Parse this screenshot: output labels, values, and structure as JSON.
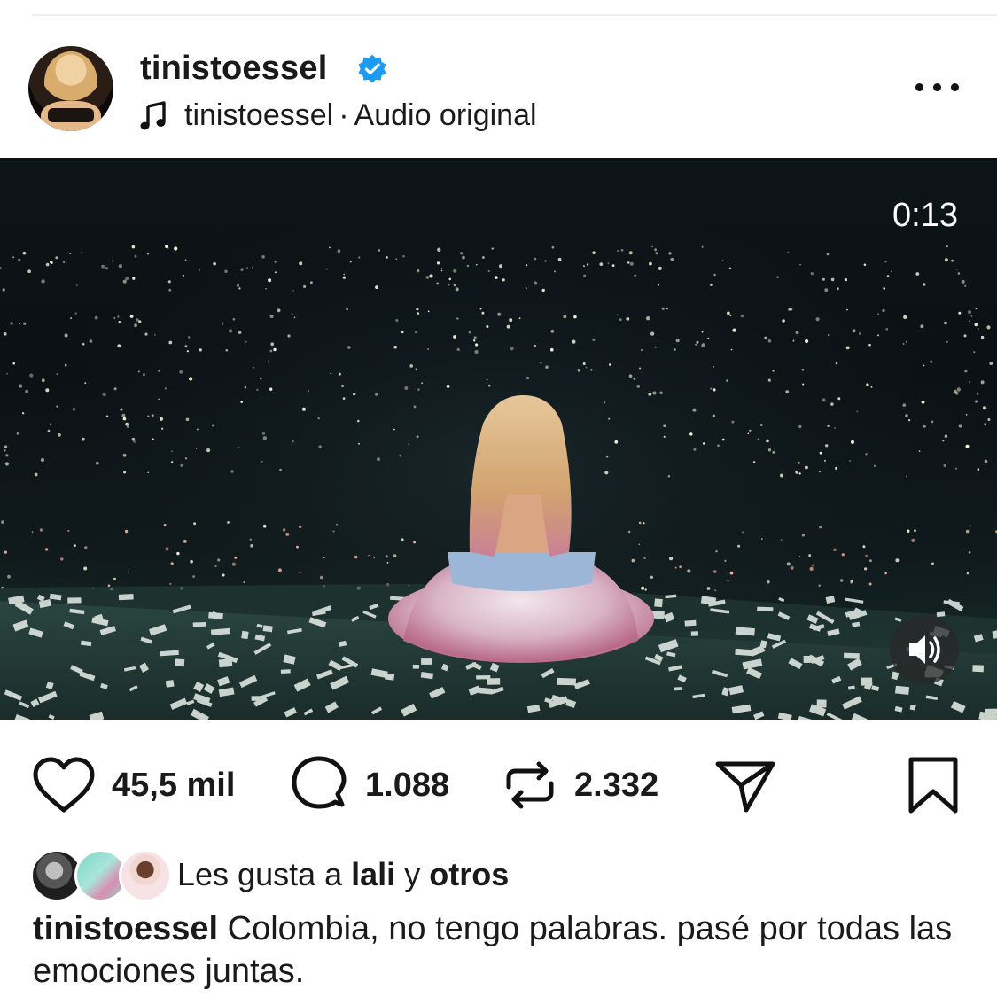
{
  "post": {
    "username": "tinistoessel",
    "audio_artist": "tinistoessel",
    "audio_separator": "·",
    "audio_label": "Audio original",
    "video_time": "0:13"
  },
  "actions": {
    "likes": "45,5 mil",
    "comments": "1.088",
    "reposts": "2.332"
  },
  "liked_by": {
    "prefix": "Les gusta a",
    "user": "lali",
    "conj": "y",
    "others": "otros"
  },
  "caption": {
    "username": "tinistoessel",
    "text": "Colombia, no tengo palabras. pasé por todas las emociones juntas."
  },
  "colors": {
    "text": "#1a1a1a",
    "verified": "#1d9bf0",
    "background": "#ffffff"
  },
  "icons": [
    "verified-badge-icon",
    "music-note-icon",
    "more-icon",
    "heart-icon",
    "comment-icon",
    "repost-icon",
    "share-icon",
    "bookmark-icon",
    "sound-on-icon"
  ]
}
